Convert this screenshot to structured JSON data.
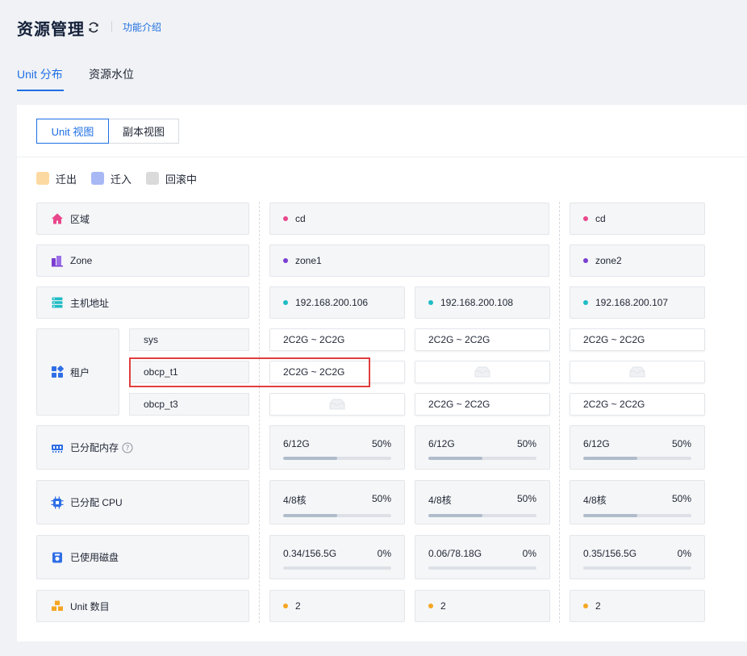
{
  "header": {
    "title": "资源管理",
    "help_link": "功能介绍"
  },
  "tabs": [
    {
      "label": "Unit 分布",
      "active": true
    },
    {
      "label": "资源水位",
      "active": false
    }
  ],
  "view_switch": {
    "options": [
      "Unit 视图",
      "副本视图"
    ],
    "selected": "Unit 视图"
  },
  "legend": [
    {
      "label": "迁出",
      "color": "#fcd9a1"
    },
    {
      "label": "迁入",
      "color": "#a7b8f5"
    },
    {
      "label": "回滚中",
      "color": "#dadada"
    }
  ],
  "rows": {
    "region": "区域",
    "zone": "Zone",
    "host": "主机地址",
    "tenant": "租户",
    "memory": "已分配内存",
    "cpu": "已分配 CPU",
    "disk": "已使用磁盘",
    "unit_count": "Unit 数目"
  },
  "tenants": [
    "sys",
    "obcp_t1",
    "obcp_t3"
  ],
  "colors": {
    "accent": "#1e6fe5",
    "region_dot": "#e8478b",
    "zone_dot": "#7a3fd1",
    "host_dot": "#1fbcc4",
    "unit_dot": "#f5a623",
    "highlight": "#e03e3e"
  },
  "zone_groups": [
    {
      "region": "cd",
      "zone": "zone1",
      "servers": [
        {
          "host": "192.168.200.106",
          "tenant_units": [
            "2C2G ~ 2C2G",
            "2C2G ~ 2C2G",
            ""
          ],
          "memory": {
            "value": "6/12G",
            "percent": "50%",
            "ratio": 0.5
          },
          "cpu": {
            "value": "4/8核",
            "percent": "50%",
            "ratio": 0.5
          },
          "disk": {
            "value": "0.34/156.5G",
            "percent": "0%",
            "ratio": 0.0
          },
          "unit_count": "2"
        },
        {
          "host": "192.168.200.108",
          "tenant_units": [
            "2C2G ~ 2C2G",
            "",
            "2C2G ~ 2C2G"
          ],
          "memory": {
            "value": "6/12G",
            "percent": "50%",
            "ratio": 0.5
          },
          "cpu": {
            "value": "4/8核",
            "percent": "50%",
            "ratio": 0.5
          },
          "disk": {
            "value": "0.06/78.18G",
            "percent": "0%",
            "ratio": 0.0
          },
          "unit_count": "2"
        }
      ]
    },
    {
      "region": "cd",
      "zone": "zone2",
      "servers": [
        {
          "host": "192.168.200.107",
          "tenant_units": [
            "2C2G ~ 2C2G",
            "",
            "2C2G ~ 2C2G"
          ],
          "memory": {
            "value": "6/12G",
            "percent": "50%",
            "ratio": 0.5
          },
          "cpu": {
            "value": "4/8核",
            "percent": "50%",
            "ratio": 0.5
          },
          "disk": {
            "value": "0.35/156.5G",
            "percent": "0%",
            "ratio": 0.0
          },
          "unit_count": "2"
        }
      ]
    }
  ]
}
